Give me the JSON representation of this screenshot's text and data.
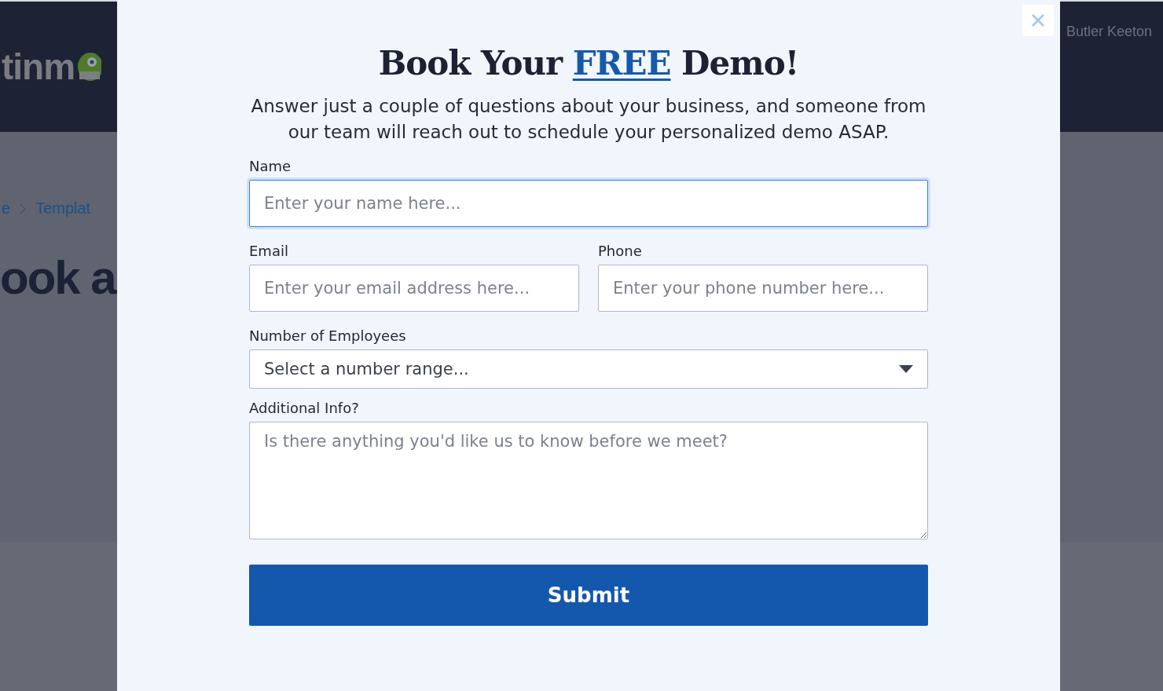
{
  "background": {
    "logo": "tinm",
    "breadcrumb": [
      "e",
      "Templat"
    ],
    "heading": "ook a",
    "user": "Butler Keeton"
  },
  "modal": {
    "title": {
      "before": "Book Your",
      "link": "FREE",
      "after": "Demo!"
    },
    "intro": "Answer just a couple of questions about your business, and someone from our team will reach out to schedule your personalized demo ASAP.",
    "fields": [
      {
        "kind": "text",
        "label": "Name",
        "placeholder": "Enter your name here...",
        "focused": true,
        "half": false
      },
      {
        "kind": "text",
        "label": "Email",
        "placeholder": "Enter your email address here...",
        "focused": false,
        "half": true
      },
      {
        "kind": "text",
        "label": "Phone",
        "placeholder": "Enter your phone number here...",
        "focused": false,
        "half": true
      },
      {
        "kind": "select",
        "label": "Number of Employees",
        "placeholder": "Select a number range...",
        "focused": false,
        "half": false
      },
      {
        "kind": "textarea",
        "label": "Additional Info?",
        "placeholder": "Is there anything you'd like us to know before we meet?",
        "focused": false,
        "half": false
      }
    ],
    "submit": "Submit"
  }
}
